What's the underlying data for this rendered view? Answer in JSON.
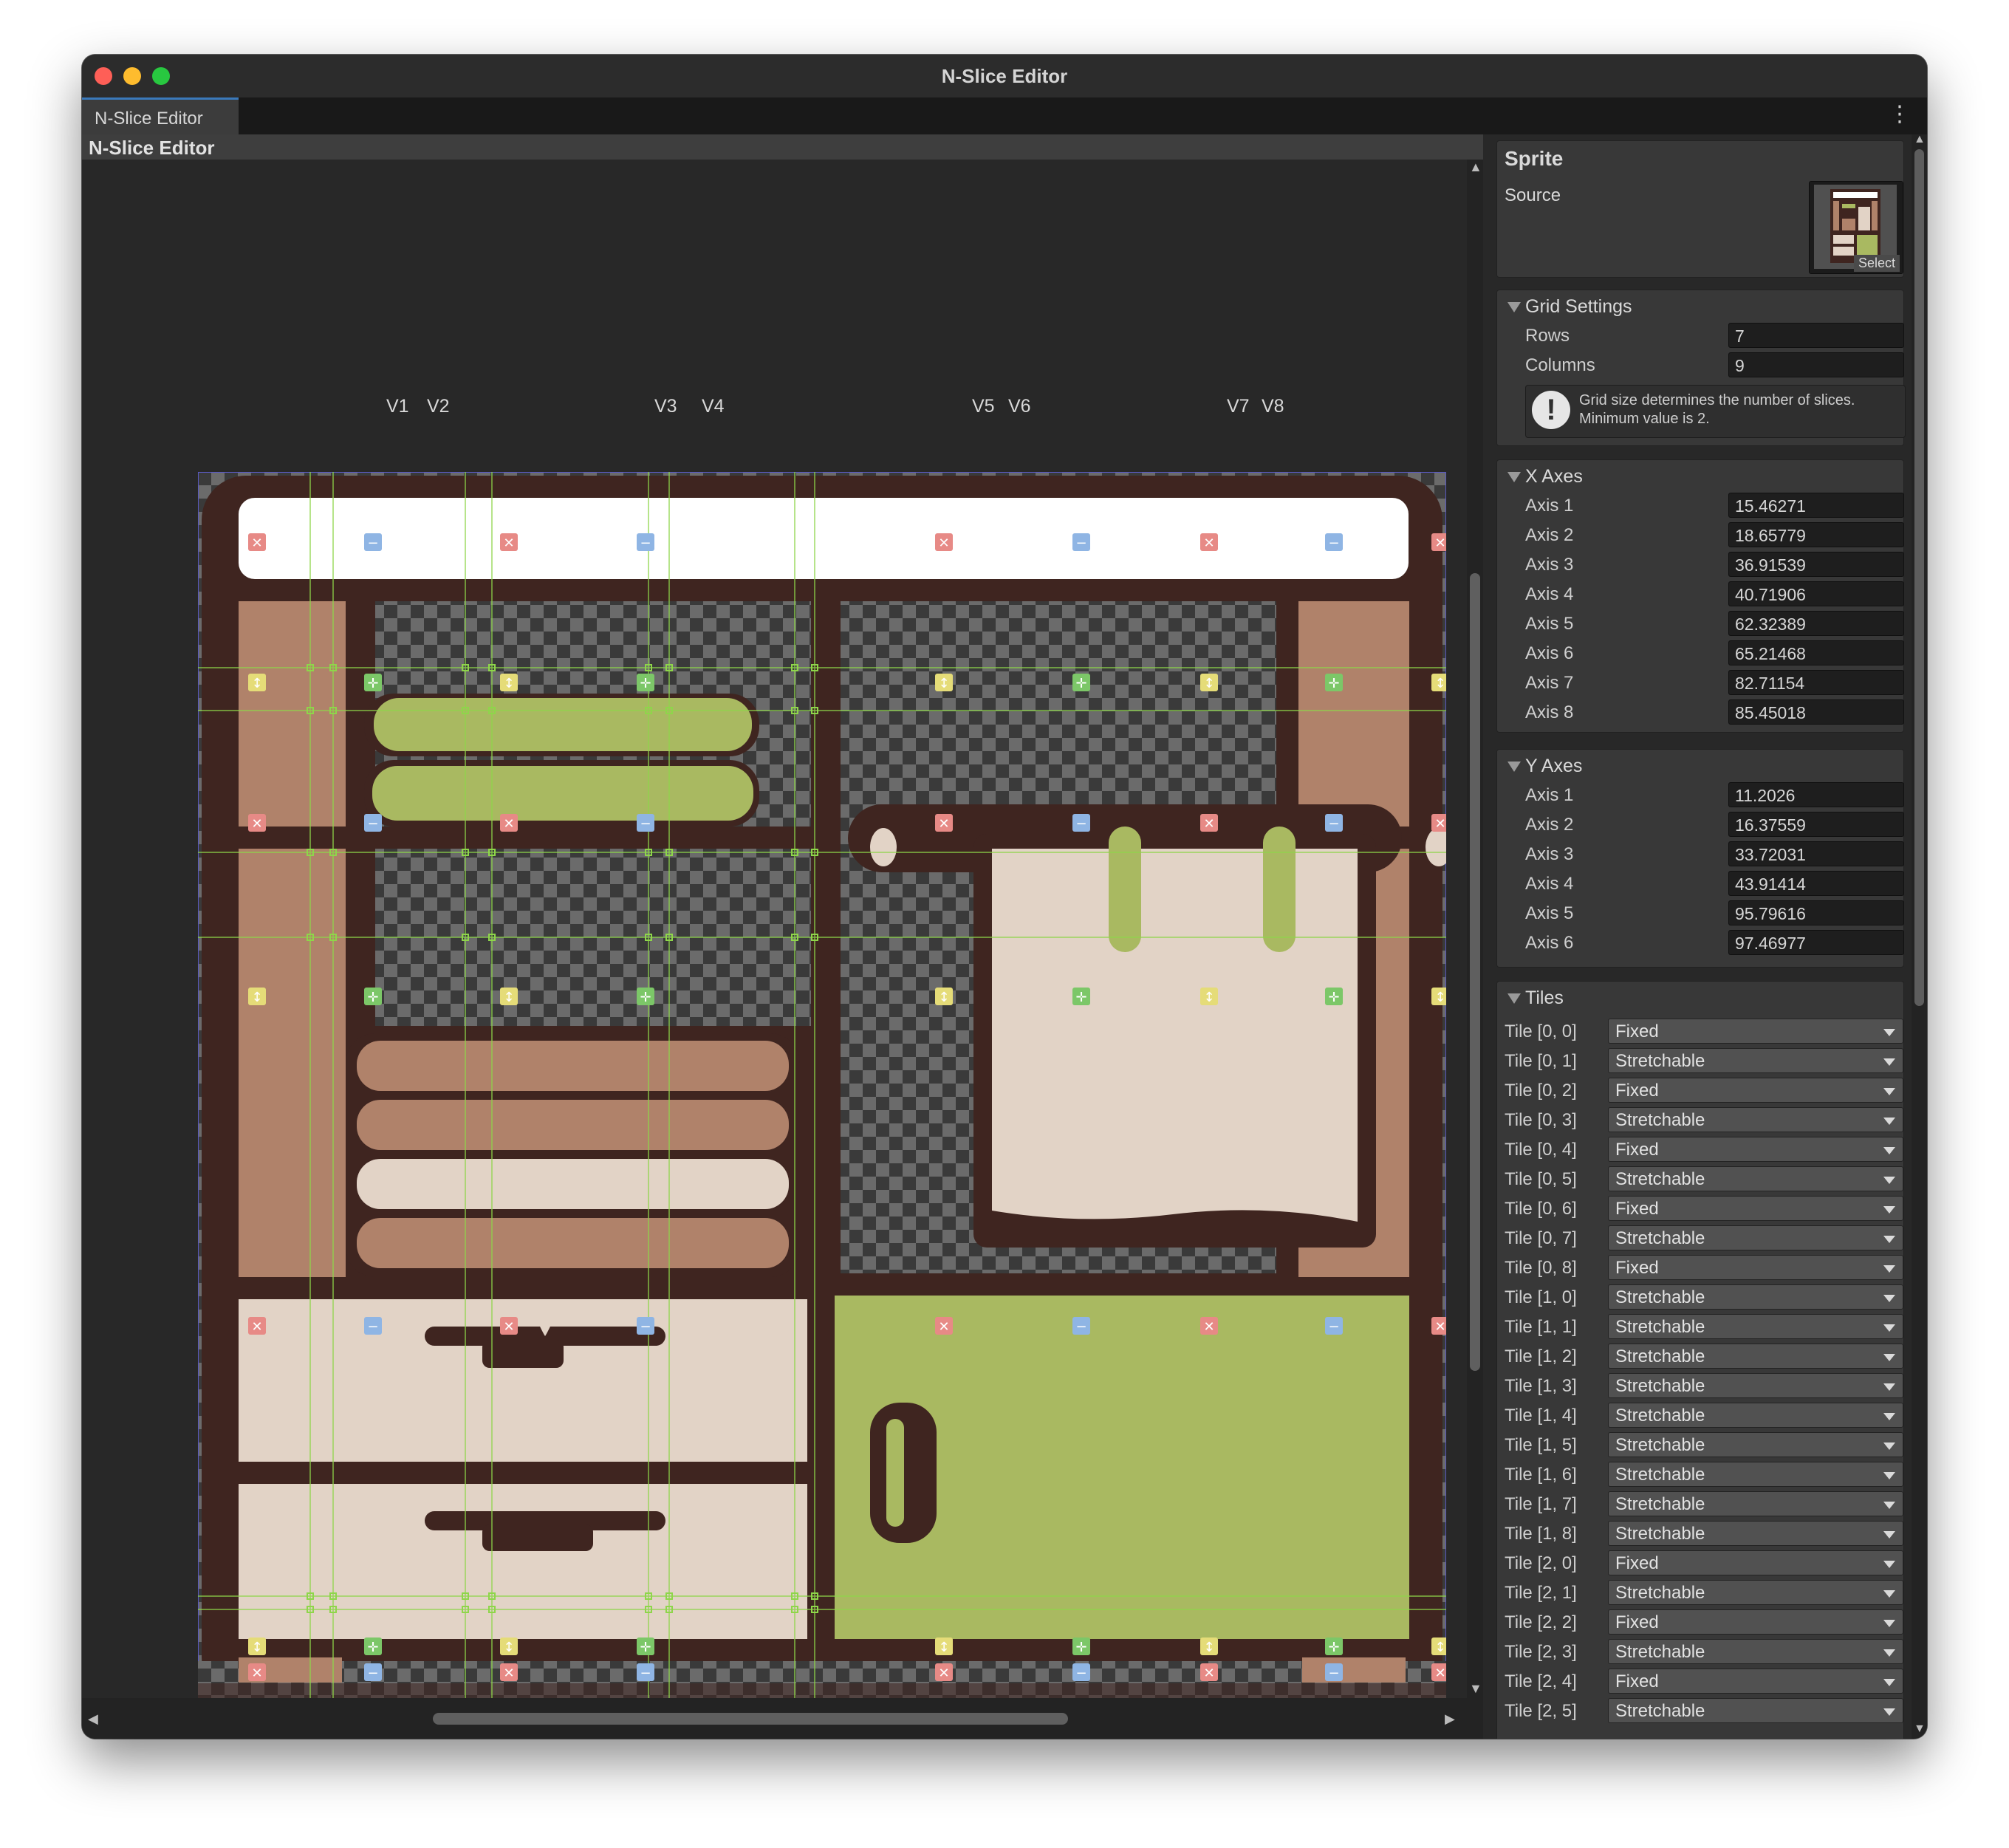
{
  "window": {
    "title": "N-Slice Editor"
  },
  "tab": {
    "label": "N-Slice Editor"
  },
  "panel": {
    "title": "N-Slice Editor"
  },
  "vertical_labels": [
    "V1",
    "V2",
    "V3",
    "V4",
    "V5",
    "V6",
    "V7",
    "V8"
  ],
  "sprite": {
    "header": "Sprite",
    "source_label": "Source",
    "select_label": "Select"
  },
  "grid_settings": {
    "header": "Grid Settings",
    "rows_label": "Rows",
    "rows_value": "7",
    "columns_label": "Columns",
    "columns_value": "9",
    "help_text": "Grid size determines the number of slices. Minimum value is 2."
  },
  "x_axes": {
    "header": "X Axes",
    "items": [
      {
        "label": "Axis 1",
        "value": "15.46271"
      },
      {
        "label": "Axis 2",
        "value": "18.65779"
      },
      {
        "label": "Axis 3",
        "value": "36.91539"
      },
      {
        "label": "Axis 4",
        "value": "40.71906"
      },
      {
        "label": "Axis 5",
        "value": "62.32389"
      },
      {
        "label": "Axis 6",
        "value": "65.21468"
      },
      {
        "label": "Axis 7",
        "value": "82.71154"
      },
      {
        "label": "Axis 8",
        "value": "85.45018"
      }
    ]
  },
  "y_axes": {
    "header": "Y Axes",
    "items": [
      {
        "label": "Axis 1",
        "value": "11.2026"
      },
      {
        "label": "Axis 2",
        "value": "16.37559"
      },
      {
        "label": "Axis 3",
        "value": "33.72031"
      },
      {
        "label": "Axis 4",
        "value": "43.91414"
      },
      {
        "label": "Axis 5",
        "value": "95.79616"
      },
      {
        "label": "Axis 6",
        "value": "97.46977"
      }
    ]
  },
  "tiles": {
    "header": "Tiles",
    "items": [
      {
        "label": "Tile [0, 0]",
        "value": "Fixed"
      },
      {
        "label": "Tile [0, 1]",
        "value": "Stretchable"
      },
      {
        "label": "Tile [0, 2]",
        "value": "Fixed"
      },
      {
        "label": "Tile [0, 3]",
        "value": "Stretchable"
      },
      {
        "label": "Tile [0, 4]",
        "value": "Fixed"
      },
      {
        "label": "Tile [0, 5]",
        "value": "Stretchable"
      },
      {
        "label": "Tile [0, 6]",
        "value": "Fixed"
      },
      {
        "label": "Tile [0, 7]",
        "value": "Stretchable"
      },
      {
        "label": "Tile [0, 8]",
        "value": "Fixed"
      },
      {
        "label": "Tile [1, 0]",
        "value": "Stretchable"
      },
      {
        "label": "Tile [1, 1]",
        "value": "Stretchable"
      },
      {
        "label": "Tile [1, 2]",
        "value": "Stretchable"
      },
      {
        "label": "Tile [1, 3]",
        "value": "Stretchable"
      },
      {
        "label": "Tile [1, 4]",
        "value": "Stretchable"
      },
      {
        "label": "Tile [1, 5]",
        "value": "Stretchable"
      },
      {
        "label": "Tile [1, 6]",
        "value": "Stretchable"
      },
      {
        "label": "Tile [1, 7]",
        "value": "Stretchable"
      },
      {
        "label": "Tile [1, 8]",
        "value": "Stretchable"
      },
      {
        "label": "Tile [2, 0]",
        "value": "Fixed"
      },
      {
        "label": "Tile [2, 1]",
        "value": "Stretchable"
      },
      {
        "label": "Tile [2, 2]",
        "value": "Fixed"
      },
      {
        "label": "Tile [2, 3]",
        "value": "Stretchable"
      },
      {
        "label": "Tile [2, 4]",
        "value": "Fixed"
      },
      {
        "label": "Tile [2, 5]",
        "value": "Stretchable"
      }
    ]
  },
  "colors": {
    "frame": "#3f2520",
    "shelf_brown": "#b0826a",
    "cream": "#e2d3c6",
    "green": "#a9b961",
    "guide": "#8ed64a",
    "marker_fixed": "#e78a86",
    "marker_stretch": "#8fb5e4",
    "marker_vertical": "#e5dc78",
    "marker_both": "#7cc768"
  }
}
